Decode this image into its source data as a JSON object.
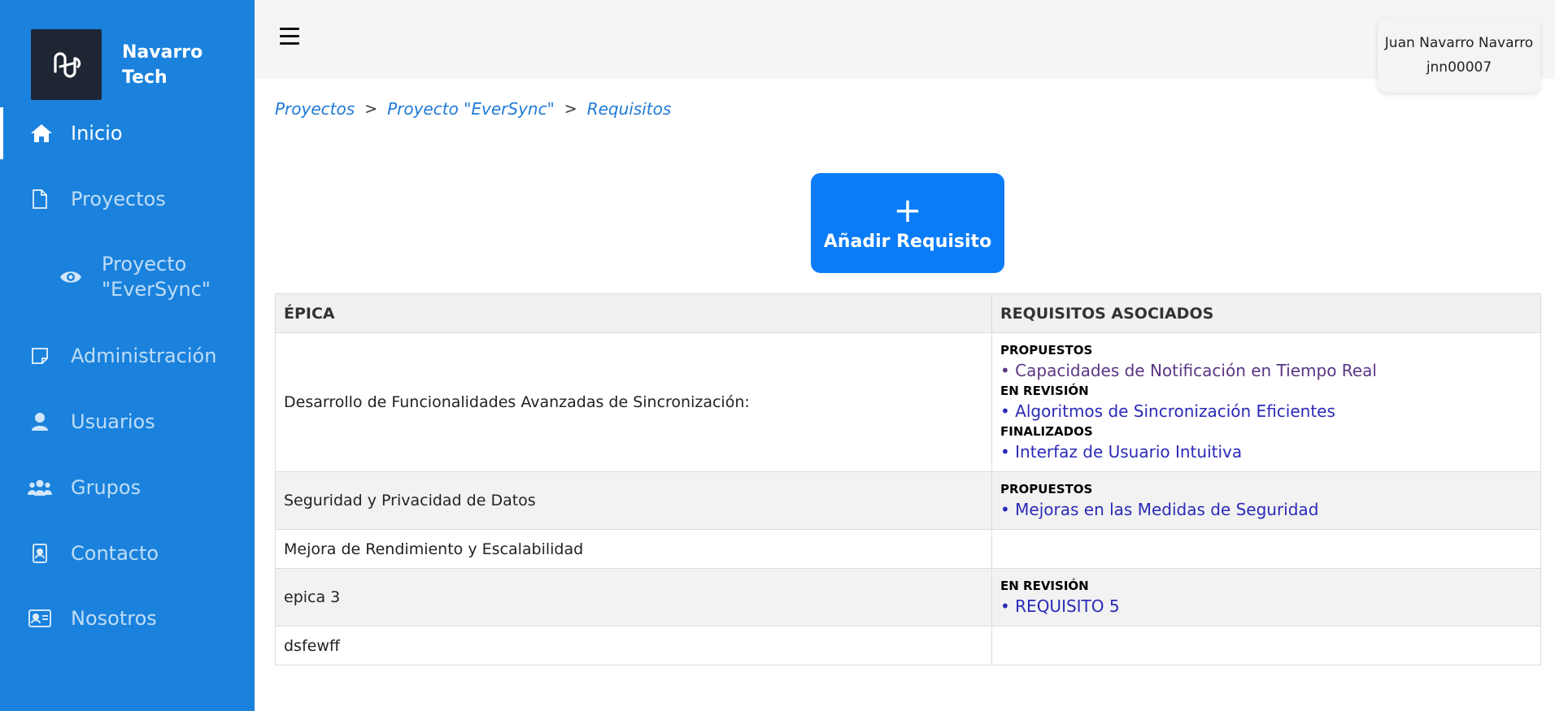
{
  "brand": {
    "name": "Navarro Tech",
    "logo_icon": "infinity-logo-icon"
  },
  "sidebar": {
    "items": [
      {
        "label": "Inicio",
        "icon": "home-icon",
        "active": true
      },
      {
        "label": "Proyectos",
        "icon": "document-icon"
      },
      {
        "label": "Proyecto \"EverSync\"",
        "icon": "eye-icon",
        "sub": true
      },
      {
        "label": "Administración",
        "icon": "note-icon"
      },
      {
        "label": "Usuarios",
        "icon": "user-icon"
      },
      {
        "label": "Grupos",
        "icon": "group-icon"
      },
      {
        "label": "Contacto",
        "icon": "contact-badge-icon"
      },
      {
        "label": "Nosotros",
        "icon": "id-card-icon"
      }
    ]
  },
  "user": {
    "name": "Juan Navarro Navarro",
    "username": "jnn00007"
  },
  "breadcrumb": {
    "items": [
      "Proyectos",
      "Proyecto \"EverSync\"",
      "Requisitos"
    ],
    "separator": ">"
  },
  "add_button": {
    "icon": "+",
    "label": "Añadir Requisito"
  },
  "table": {
    "headers": {
      "epic": "ÉPICA",
      "requirements": "REQUISITOS ASOCIADOS"
    },
    "rows": [
      {
        "epic": "Desarrollo de Funcionalidades Avanzadas de Sincronización:",
        "groups": [
          {
            "status": "PROPUESTOS",
            "items": [
              "• Capacidades de Notificación en Tiempo Real"
            ]
          },
          {
            "status": "EN REVISIÓN",
            "items": [
              "• Algoritmos de Sincronización Eficientes"
            ]
          },
          {
            "status": "FINALIZADOS",
            "items": [
              "• Interfaz de Usuario Intuitiva"
            ]
          }
        ]
      },
      {
        "epic": "Seguridad y Privacidad de Datos",
        "groups": [
          {
            "status": "PROPUESTOS",
            "items": [
              "• Mejoras en las Medidas de Seguridad"
            ]
          }
        ]
      },
      {
        "epic": "Mejora de Rendimiento y Escalabilidad",
        "groups": []
      },
      {
        "epic": "epica 3",
        "groups": [
          {
            "status": "EN REVISIÓN",
            "items": [
              "• REQUISITO 5"
            ]
          }
        ]
      },
      {
        "epic": "dsfewff",
        "groups": []
      }
    ]
  },
  "colors": {
    "sidebar": "#1a82dd",
    "accent": "#0a7cf7",
    "link": "#2a2ab8",
    "visited_link": "#5a3584"
  }
}
